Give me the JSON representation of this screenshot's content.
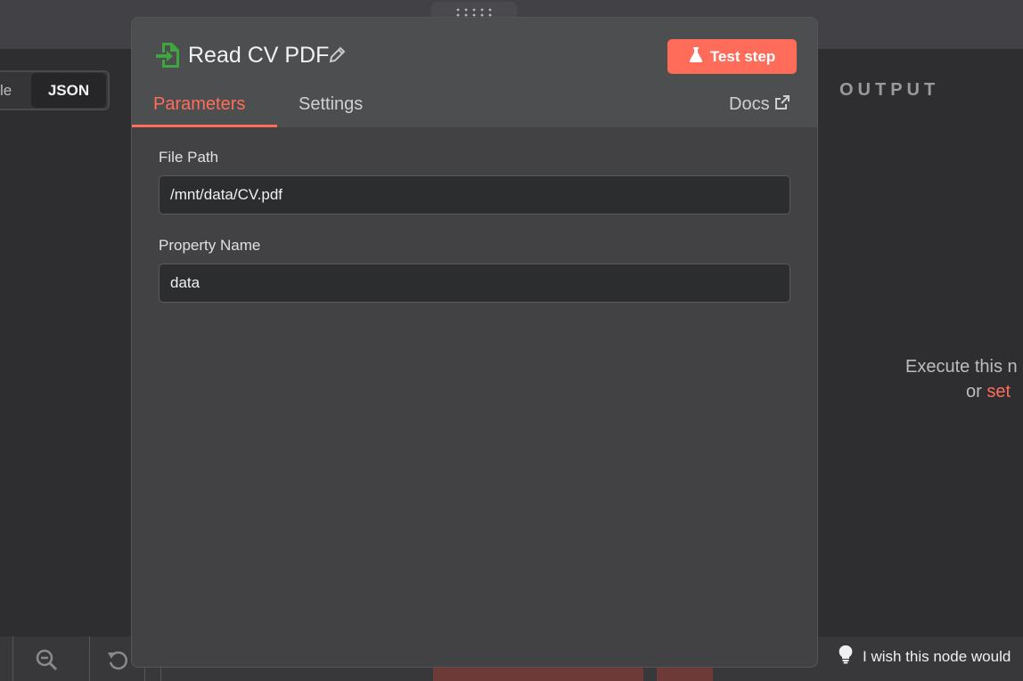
{
  "background": {
    "view_toggle": {
      "table_label": "le",
      "json_label": "JSON"
    },
    "output_label": "OUTPUT",
    "execute_hint": {
      "line1": "Execute this n",
      "or_text": "or",
      "set_link": "set"
    },
    "bottom_bar": {
      "wish_text": "I wish this node would"
    }
  },
  "node": {
    "title": "Read CV PDF",
    "test_step_label": "Test step",
    "tabs": [
      {
        "label": "Parameters",
        "active": true
      },
      {
        "label": "Settings",
        "active": false
      }
    ],
    "docs_label": "Docs",
    "fields": [
      {
        "label": "File Path",
        "value": "/mnt/data/CV.pdf"
      },
      {
        "label": "Property Name",
        "value": "data"
      }
    ]
  },
  "colors": {
    "accent": "#ff6d5a",
    "node_icon": "#3fa63f"
  },
  "icons": [
    "file-import-icon",
    "pencil-icon",
    "flask-icon",
    "external-link-icon",
    "zoom-out-icon",
    "undo-icon",
    "lightbulb-icon",
    "drag-grip-icon"
  ]
}
